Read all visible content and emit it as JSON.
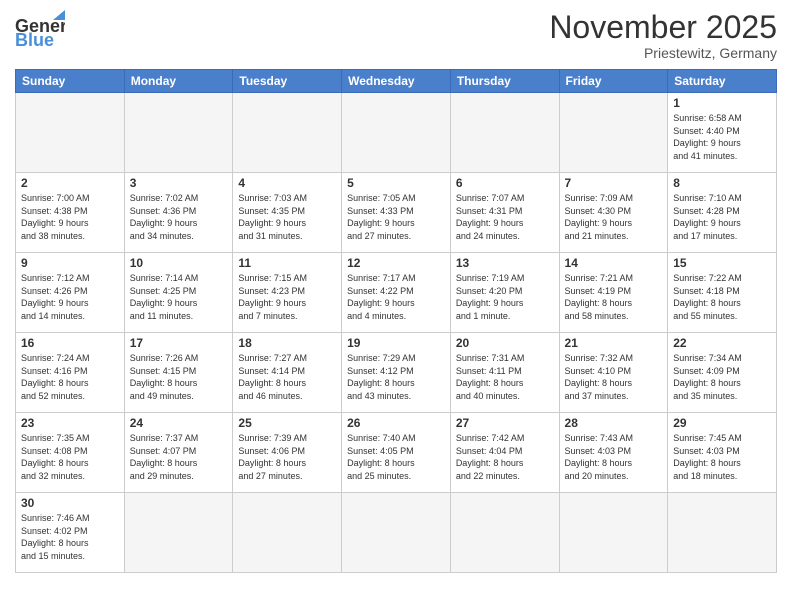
{
  "header": {
    "logo": {
      "part1": "General",
      "part2": "Blue"
    },
    "title": "November 2025",
    "subtitle": "Priestewitz, Germany"
  },
  "weekdays": [
    "Sunday",
    "Monday",
    "Tuesday",
    "Wednesday",
    "Thursday",
    "Friday",
    "Saturday"
  ],
  "weeks": [
    [
      {
        "day": "",
        "info": ""
      },
      {
        "day": "",
        "info": ""
      },
      {
        "day": "",
        "info": ""
      },
      {
        "day": "",
        "info": ""
      },
      {
        "day": "",
        "info": ""
      },
      {
        "day": "",
        "info": ""
      },
      {
        "day": "1",
        "info": "Sunrise: 6:58 AM\nSunset: 4:40 PM\nDaylight: 9 hours\nand 41 minutes."
      }
    ],
    [
      {
        "day": "2",
        "info": "Sunrise: 7:00 AM\nSunset: 4:38 PM\nDaylight: 9 hours\nand 38 minutes."
      },
      {
        "day": "3",
        "info": "Sunrise: 7:02 AM\nSunset: 4:36 PM\nDaylight: 9 hours\nand 34 minutes."
      },
      {
        "day": "4",
        "info": "Sunrise: 7:03 AM\nSunset: 4:35 PM\nDaylight: 9 hours\nand 31 minutes."
      },
      {
        "day": "5",
        "info": "Sunrise: 7:05 AM\nSunset: 4:33 PM\nDaylight: 9 hours\nand 27 minutes."
      },
      {
        "day": "6",
        "info": "Sunrise: 7:07 AM\nSunset: 4:31 PM\nDaylight: 9 hours\nand 24 minutes."
      },
      {
        "day": "7",
        "info": "Sunrise: 7:09 AM\nSunset: 4:30 PM\nDaylight: 9 hours\nand 21 minutes."
      },
      {
        "day": "8",
        "info": "Sunrise: 7:10 AM\nSunset: 4:28 PM\nDaylight: 9 hours\nand 17 minutes."
      }
    ],
    [
      {
        "day": "9",
        "info": "Sunrise: 7:12 AM\nSunset: 4:26 PM\nDaylight: 9 hours\nand 14 minutes."
      },
      {
        "day": "10",
        "info": "Sunrise: 7:14 AM\nSunset: 4:25 PM\nDaylight: 9 hours\nand 11 minutes."
      },
      {
        "day": "11",
        "info": "Sunrise: 7:15 AM\nSunset: 4:23 PM\nDaylight: 9 hours\nand 7 minutes."
      },
      {
        "day": "12",
        "info": "Sunrise: 7:17 AM\nSunset: 4:22 PM\nDaylight: 9 hours\nand 4 minutes."
      },
      {
        "day": "13",
        "info": "Sunrise: 7:19 AM\nSunset: 4:20 PM\nDaylight: 9 hours\nand 1 minute."
      },
      {
        "day": "14",
        "info": "Sunrise: 7:21 AM\nSunset: 4:19 PM\nDaylight: 8 hours\nand 58 minutes."
      },
      {
        "day": "15",
        "info": "Sunrise: 7:22 AM\nSunset: 4:18 PM\nDaylight: 8 hours\nand 55 minutes."
      }
    ],
    [
      {
        "day": "16",
        "info": "Sunrise: 7:24 AM\nSunset: 4:16 PM\nDaylight: 8 hours\nand 52 minutes."
      },
      {
        "day": "17",
        "info": "Sunrise: 7:26 AM\nSunset: 4:15 PM\nDaylight: 8 hours\nand 49 minutes."
      },
      {
        "day": "18",
        "info": "Sunrise: 7:27 AM\nSunset: 4:14 PM\nDaylight: 8 hours\nand 46 minutes."
      },
      {
        "day": "19",
        "info": "Sunrise: 7:29 AM\nSunset: 4:12 PM\nDaylight: 8 hours\nand 43 minutes."
      },
      {
        "day": "20",
        "info": "Sunrise: 7:31 AM\nSunset: 4:11 PM\nDaylight: 8 hours\nand 40 minutes."
      },
      {
        "day": "21",
        "info": "Sunrise: 7:32 AM\nSunset: 4:10 PM\nDaylight: 8 hours\nand 37 minutes."
      },
      {
        "day": "22",
        "info": "Sunrise: 7:34 AM\nSunset: 4:09 PM\nDaylight: 8 hours\nand 35 minutes."
      }
    ],
    [
      {
        "day": "23",
        "info": "Sunrise: 7:35 AM\nSunset: 4:08 PM\nDaylight: 8 hours\nand 32 minutes."
      },
      {
        "day": "24",
        "info": "Sunrise: 7:37 AM\nSunset: 4:07 PM\nDaylight: 8 hours\nand 29 minutes."
      },
      {
        "day": "25",
        "info": "Sunrise: 7:39 AM\nSunset: 4:06 PM\nDaylight: 8 hours\nand 27 minutes."
      },
      {
        "day": "26",
        "info": "Sunrise: 7:40 AM\nSunset: 4:05 PM\nDaylight: 8 hours\nand 25 minutes."
      },
      {
        "day": "27",
        "info": "Sunrise: 7:42 AM\nSunset: 4:04 PM\nDaylight: 8 hours\nand 22 minutes."
      },
      {
        "day": "28",
        "info": "Sunrise: 7:43 AM\nSunset: 4:03 PM\nDaylight: 8 hours\nand 20 minutes."
      },
      {
        "day": "29",
        "info": "Sunrise: 7:45 AM\nSunset: 4:03 PM\nDaylight: 8 hours\nand 18 minutes."
      }
    ],
    [
      {
        "day": "30",
        "info": "Sunrise: 7:46 AM\nSunset: 4:02 PM\nDaylight: 8 hours\nand 15 minutes."
      },
      {
        "day": "",
        "info": ""
      },
      {
        "day": "",
        "info": ""
      },
      {
        "day": "",
        "info": ""
      },
      {
        "day": "",
        "info": ""
      },
      {
        "day": "",
        "info": ""
      },
      {
        "day": "",
        "info": ""
      }
    ]
  ]
}
